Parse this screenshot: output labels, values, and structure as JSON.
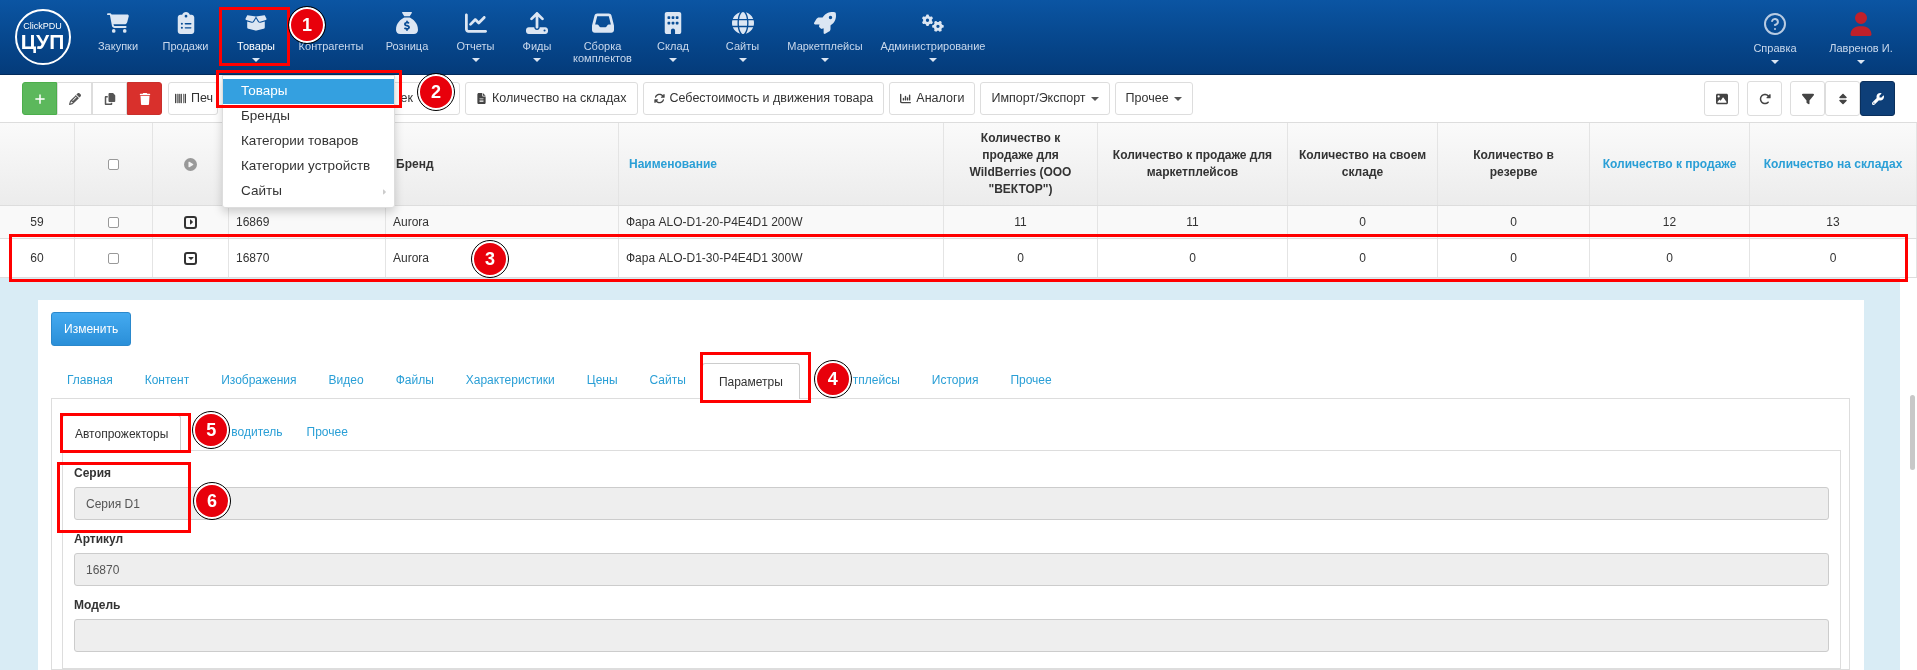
{
  "nav": {
    "logo": {
      "top": "ClickPDU",
      "main": "ЦУП"
    },
    "items": [
      {
        "label": "Закупки",
        "selected": false,
        "caret": false
      },
      {
        "label": "Продажи",
        "selected": false,
        "caret": false
      },
      {
        "label": "Товары",
        "selected": true,
        "caret": true
      },
      {
        "label": "Контрагенты",
        "selected": false,
        "caret": false
      },
      {
        "label": "Розница",
        "selected": false,
        "caret": false
      },
      {
        "label": "Отчеты",
        "selected": false,
        "caret": true
      },
      {
        "label": "Фиды",
        "selected": false,
        "caret": true
      },
      {
        "label": "Сборка комплектов",
        "selected": false,
        "caret": false
      },
      {
        "label": "Склад",
        "selected": false,
        "caret": true
      },
      {
        "label": "Сайты",
        "selected": false,
        "caret": true
      },
      {
        "label": "Маркетплейсы",
        "selected": false,
        "caret": true
      },
      {
        "label": "Администрирование",
        "selected": false,
        "caret": true
      }
    ],
    "right": [
      {
        "label": "Справка",
        "caret": true
      },
      {
        "label": "Лавренов И.",
        "caret": true
      }
    ]
  },
  "nav_menu": {
    "items": [
      {
        "label": "Товары",
        "selected": true,
        "submenu": false
      },
      {
        "label": "Бренды",
        "selected": false,
        "submenu": false
      },
      {
        "label": "Категории товаров",
        "selected": false,
        "submenu": false
      },
      {
        "label": "Категории устройств",
        "selected": false,
        "submenu": false
      },
      {
        "label": "Сайты",
        "selected": false,
        "submenu": true
      }
    ]
  },
  "toolbar": {
    "buttons": [
      {
        "kind": "add"
      },
      {
        "kind": "edit"
      },
      {
        "kind": "copy"
      },
      {
        "kind": "delete"
      },
      {
        "kind": "text",
        "label": "Печ",
        "caret": false
      },
      {
        "kind": "text",
        "label": "ек",
        "caret": false
      },
      {
        "kind": "text",
        "label": "Количество на складах",
        "caret": false
      },
      {
        "kind": "text",
        "label": "Себестоимость и движения товара",
        "caret": false
      },
      {
        "kind": "text",
        "label": "Аналоги",
        "caret": false
      },
      {
        "kind": "text",
        "label": "Импорт/Экспорт",
        "caret": true
      },
      {
        "kind": "text",
        "label": "Прочее",
        "caret": true
      }
    ],
    "tools": [
      {
        "active": false
      },
      {
        "active": false
      },
      {
        "active": false
      },
      {
        "active": false
      },
      {
        "active": true
      }
    ]
  },
  "table": {
    "header_checkbox": {
      "checked": false
    },
    "columns": [
      {
        "kind": "blank"
      },
      {
        "kind": "text",
        "label": "Бренд",
        "sortable": false
      },
      {
        "kind": "text",
        "label": "Наименование",
        "sortable": true
      },
      {
        "kind": "text",
        "label": "Количество к продаже для WildBerries (ООО \"ВЕКТОР\")",
        "sortable": false
      },
      {
        "kind": "text",
        "label": "Количество к продаже для маркетплейсов",
        "sortable": false
      },
      {
        "kind": "text",
        "label": "Количество на своем складе",
        "sortable": false
      },
      {
        "kind": "text",
        "label": "Количество в резерве",
        "sortable": false
      },
      {
        "kind": "text",
        "label": "Количество к продаже",
        "sortable": true
      },
      {
        "kind": "text",
        "label": "Количество на складах",
        "sortable": true
      }
    ],
    "rows": [
      {
        "number": "59",
        "checked": false,
        "expanded": false,
        "cells": [
          "16869",
          "Aurora",
          "Фара ALO-D1-20-P4E4D1 200W",
          "11",
          "11",
          "0",
          "0",
          "12",
          "13"
        ]
      },
      {
        "number": "60",
        "checked": false,
        "expanded": true,
        "cells": [
          "16870",
          "Aurora",
          "Фара ALO-D1-30-P4E4D1 300W",
          "0",
          "0",
          "0",
          "0",
          "0",
          "0"
        ]
      }
    ]
  },
  "detail": {
    "edit_button": "Изменить",
    "tabs": [
      {
        "label": "Главная",
        "selected": false
      },
      {
        "label": "Контент",
        "selected": false
      },
      {
        "label": "Изображения",
        "selected": false
      },
      {
        "label": "Видео",
        "selected": false
      },
      {
        "label": "Файлы",
        "selected": false
      },
      {
        "label": "Характеристики",
        "selected": false
      },
      {
        "label": "Цены",
        "selected": false
      },
      {
        "label": "Сайты",
        "selected": false
      },
      {
        "label": "Параметры",
        "selected": true
      },
      {
        "label": "тплейсы",
        "selected": false
      },
      {
        "label": "История",
        "selected": false
      },
      {
        "label": "Прочее",
        "selected": false
      }
    ],
    "subtabs": [
      {
        "label": "Автопрожекторы",
        "selected": true
      },
      {
        "label": "водитель",
        "selected": false
      },
      {
        "label": "Прочее",
        "selected": false
      }
    ],
    "fields": [
      {
        "label": "Серия",
        "value": "Серия D1"
      },
      {
        "label": "Артикул",
        "value": "16870"
      },
      {
        "label": "Модель"
      }
    ]
  },
  "callouts": [
    {
      "number": "1"
    },
    {
      "number": "2"
    },
    {
      "number": "3"
    },
    {
      "number": "4"
    },
    {
      "number": "5"
    },
    {
      "number": "6"
    }
  ]
}
